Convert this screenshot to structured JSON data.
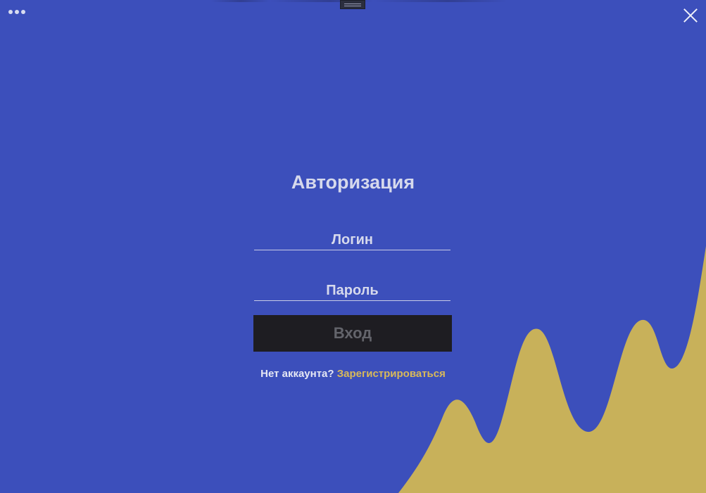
{
  "window": {
    "menu_icon": "more-dots-icon",
    "close_icon": "close-icon"
  },
  "auth": {
    "title": "Авторизация",
    "login_placeholder": "Логин",
    "password_placeholder": "Пароль",
    "submit_label": "Вход",
    "no_account_text": "Нет аккаунта?",
    "register_link": "Зарегистрироваться"
  },
  "colors": {
    "background": "#3c4fbb",
    "wave": "#c8b15a",
    "button": "#1e1d22",
    "link": "#d8b95a"
  }
}
